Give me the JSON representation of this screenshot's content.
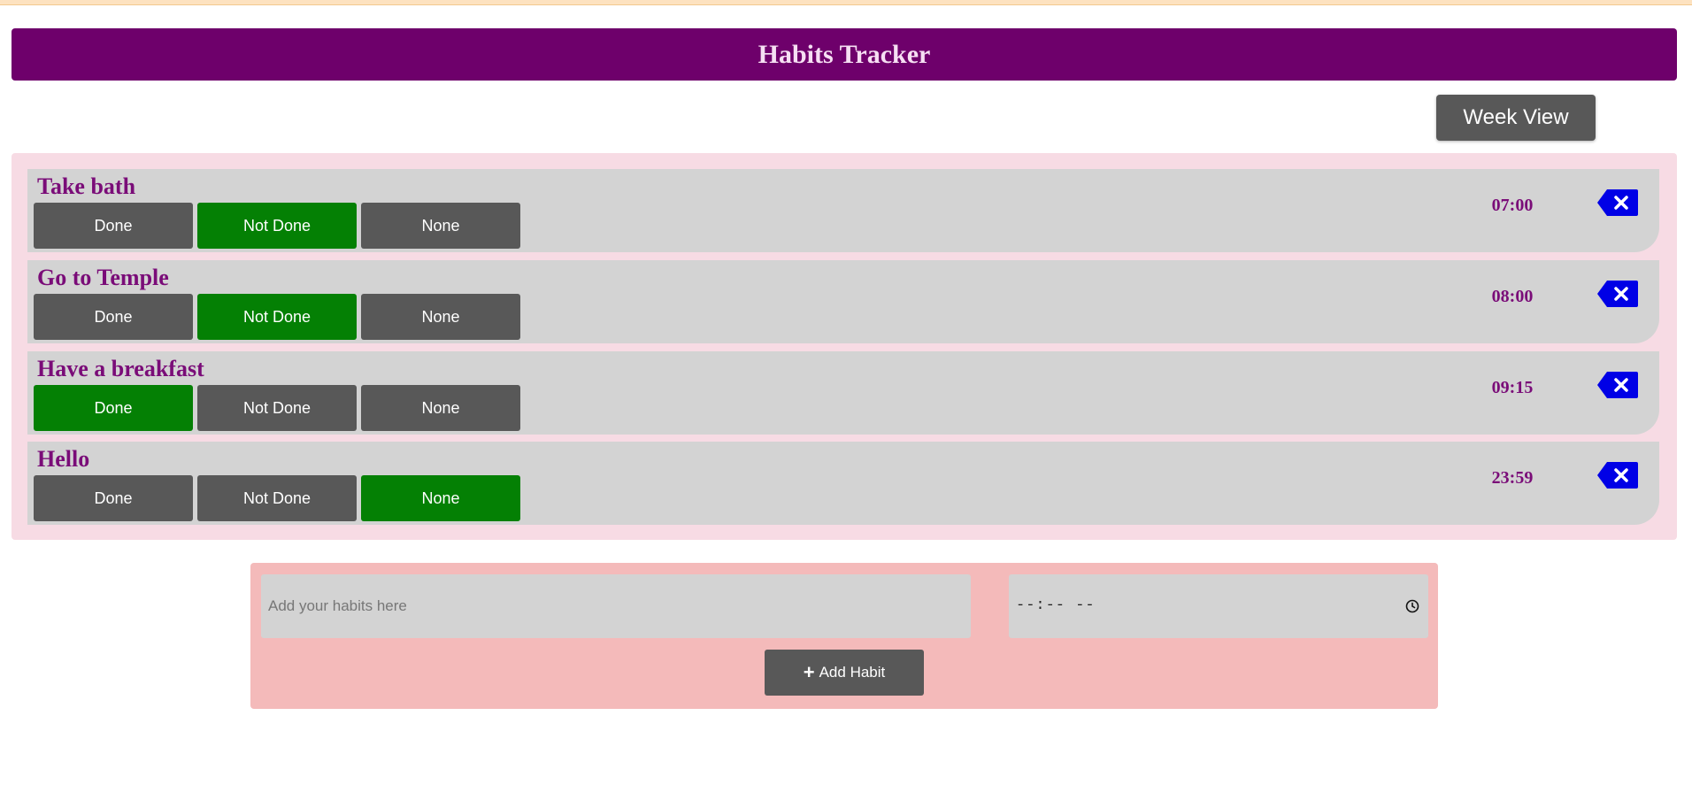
{
  "header": {
    "title": "Habits Tracker"
  },
  "toolbar": {
    "week_view_label": "Week View"
  },
  "status_labels": [
    "Done",
    "Not Done",
    "None"
  ],
  "habits": [
    {
      "name": "Take bath",
      "time": "07:00",
      "selected": "Not Done"
    },
    {
      "name": "Go to Temple",
      "time": "08:00",
      "selected": "Not Done"
    },
    {
      "name": "Have a breakfast",
      "time": "09:15",
      "selected": "Done"
    },
    {
      "name": "Hello",
      "time": "23:59",
      "selected": "None"
    }
  ],
  "add_form": {
    "habit_placeholder": "Add your habits here",
    "time_placeholder": "--:-- --",
    "add_button_label": "Add Habit"
  },
  "colors": {
    "header_bg": "#6e006b",
    "active_status": "#048004",
    "inactive_status": "#585858",
    "delete_button": "#0000e6",
    "habit_text": "#7a0c78",
    "list_bg": "#f7dbe4",
    "form_bg": "#f4baba"
  },
  "icons": {
    "delete": "backspace-icon",
    "add": "plus-icon",
    "time": "clock-icon"
  }
}
